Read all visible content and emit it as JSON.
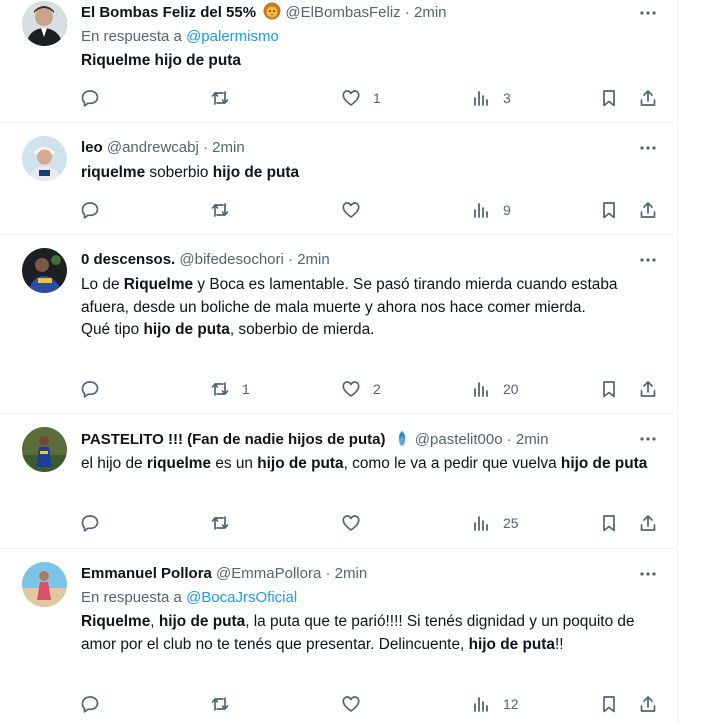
{
  "tweets": [
    {
      "name": "El Bombas Feliz del 55%",
      "handle": "@ElBombasFeliz",
      "dot": "·",
      "time": "2min",
      "reply_prefix": "En respuesta a",
      "reply_mention": "@palermismo",
      "body_segments": [
        {
          "text": "Riquelme hijo de puta",
          "bold": true
        }
      ],
      "reply_count": "",
      "retweet_count": "",
      "like_count": "1",
      "view_count": "3"
    },
    {
      "name": "leo",
      "handle": "@andrewcabj",
      "dot": "·",
      "time": "2min",
      "body_segments": [
        {
          "text": "riquelme",
          "bold": true
        },
        {
          "text": " soberbio ",
          "bold": false
        },
        {
          "text": "hijo de puta",
          "bold": true
        }
      ],
      "reply_count": "",
      "retweet_count": "",
      "like_count": "",
      "view_count": "9"
    },
    {
      "name": "0 descensos.",
      "handle": "@bifedesochori",
      "dot": "·",
      "time": "2min",
      "body_segments": [
        {
          "text": "Lo de ",
          "bold": false
        },
        {
          "text": "Riquelme",
          "bold": true
        },
        {
          "text": " y Boca es lamentable. Se pasó tirando mierda cuando estaba afuera, desde un boliche de mala muerte y ahora nos hace comer mierda.",
          "bold": false
        },
        {
          "text": "\n",
          "bold": false
        },
        {
          "text": "Qué tipo ",
          "bold": false
        },
        {
          "text": "hijo de puta",
          "bold": true
        },
        {
          "text": ", soberbio de mierda.",
          "bold": false
        }
      ],
      "reply_count": "",
      "retweet_count": "1",
      "like_count": "2",
      "view_count": "20"
    },
    {
      "name": "PASTELITO !!! (Fan de nadie hijos de puta)",
      "name_emoji": "flip-flop-emoji",
      "handle": "@pastelit00o",
      "dot": "·",
      "time": "2min",
      "body_segments": [
        {
          "text": "el hijo de ",
          "bold": false
        },
        {
          "text": "riquelme",
          "bold": true
        },
        {
          "text": " es un ",
          "bold": false
        },
        {
          "text": "hijo de puta",
          "bold": true
        },
        {
          "text": ", como le va a pedir que vuelva ",
          "bold": false
        },
        {
          "text": "hijo de puta",
          "bold": true
        }
      ],
      "reply_count": "",
      "retweet_count": "",
      "like_count": "",
      "view_count": "25"
    },
    {
      "name": "Emmanuel Pollora",
      "handle": "@EmmaPollora",
      "dot": "·",
      "time": "2min",
      "reply_prefix": "En respuesta a",
      "reply_mention": "@BocaJrsOficial",
      "body_segments": [
        {
          "text": "Riquelme",
          "bold": true
        },
        {
          "text": ", ",
          "bold": false
        },
        {
          "text": "hijo de puta",
          "bold": true
        },
        {
          "text": ", la puta que te parió!!!! Si tenés dignidad y un poquito de amor por el club no te tenés que presentar. Delincuente, ",
          "bold": false
        },
        {
          "text": "hijo de puta",
          "bold": true
        },
        {
          "text": "!!",
          "bold": false
        }
      ],
      "reply_count": "",
      "retweet_count": "",
      "like_count": "",
      "view_count": "12"
    }
  ],
  "colors": {
    "text": "#0f1419",
    "secondary": "#536471",
    "link": "#1d9bf0",
    "divider": "#eff3f4"
  }
}
